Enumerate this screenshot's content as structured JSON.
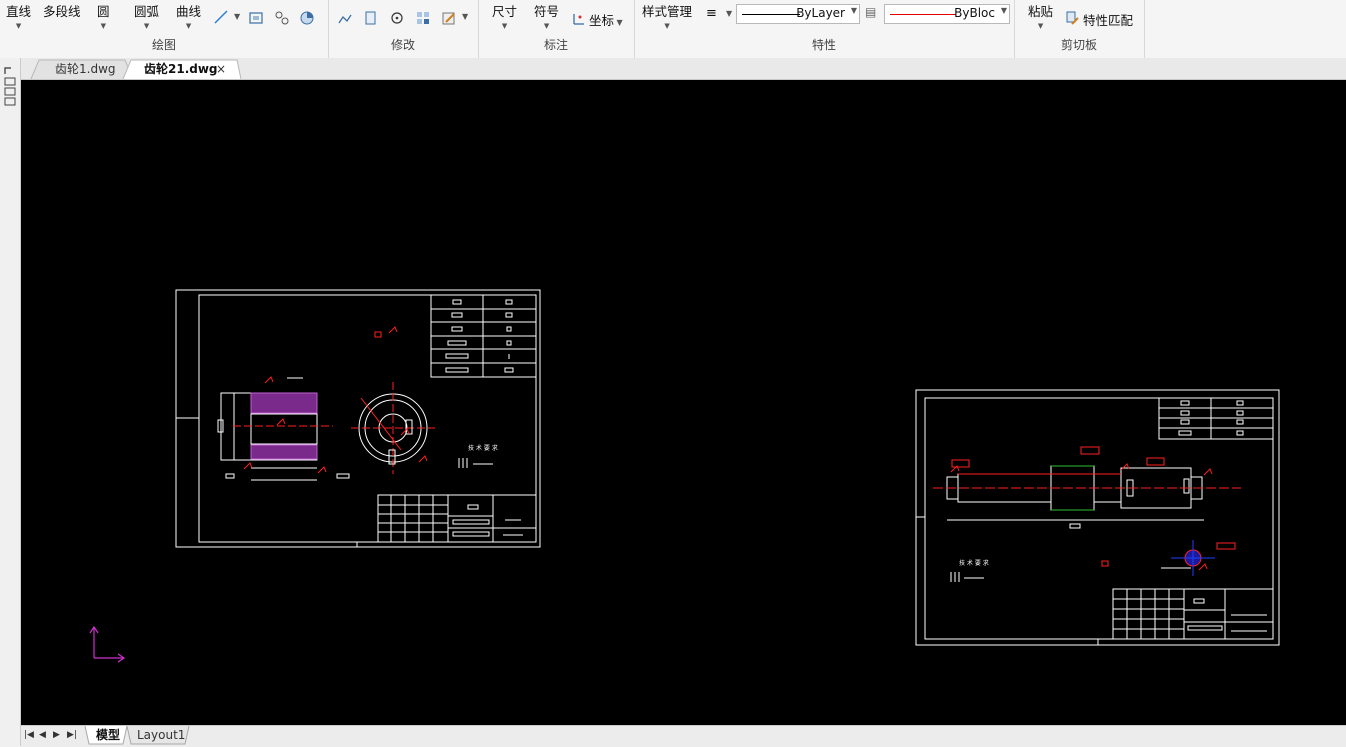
{
  "ribbon": {
    "draw": {
      "label": "绘图",
      "line": "直线",
      "polyline": "多段线",
      "circle": "圆",
      "arc": "圆弧",
      "curve": "曲线"
    },
    "modify": {
      "label": "修改"
    },
    "annotate": {
      "label": "标注",
      "dimension": "尺寸",
      "symbol": "符号",
      "coordinate": "坐标"
    },
    "properties": {
      "label": "特性",
      "style_manager": "样式管理",
      "linetype": "ByLayer",
      "color": "ByBloc"
    },
    "clipboard": {
      "label": "剪切板",
      "paste": "粘贴",
      "match_properties": "特性匹配"
    }
  },
  "tabs": {
    "doc1": "齿轮1.dwg",
    "doc2": "齿轮21.dwg",
    "close": "×"
  },
  "layout_tabs": {
    "model": "模型",
    "layout1": "Layout1"
  },
  "colors": {
    "canvas": "#000000",
    "drawing_line": "#ffffff",
    "annotation": "#ff2020",
    "hatch": "#a040c0",
    "ucs": "#d030d0"
  }
}
